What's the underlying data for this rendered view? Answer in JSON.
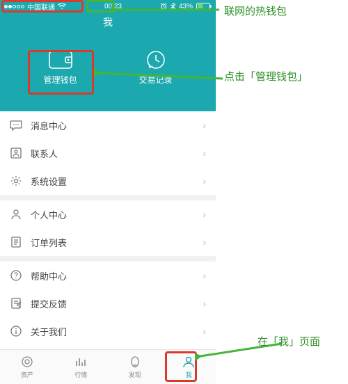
{
  "status": {
    "carrier": "中国联通",
    "time": "00:23",
    "battery_pct": "43%"
  },
  "header": {
    "title": "我",
    "actions": {
      "manage_wallet": "管理钱包",
      "tx_history": "交易记录"
    }
  },
  "menu": {
    "group1": [
      {
        "icon": "chat-icon",
        "label": "消息中心"
      },
      {
        "icon": "contact-icon",
        "label": "联系人"
      },
      {
        "icon": "gear-icon",
        "label": "系统设置"
      }
    ],
    "group2": [
      {
        "icon": "person-icon",
        "label": "个人中心"
      },
      {
        "icon": "list-icon",
        "label": "订单列表"
      }
    ],
    "group3": [
      {
        "icon": "help-icon",
        "label": "帮助中心"
      },
      {
        "icon": "feedback-icon",
        "label": "提交反馈"
      },
      {
        "icon": "info-icon",
        "label": "关于我们"
      }
    ]
  },
  "tabs": [
    {
      "icon": "assets-icon",
      "label": "资产"
    },
    {
      "icon": "market-icon",
      "label": "行情"
    },
    {
      "icon": "discover-icon",
      "label": "发现"
    },
    {
      "icon": "me-icon",
      "label": "我"
    }
  ],
  "annotations": {
    "hot_wallet": "联网的热钱包",
    "click_manage": "点击「管理钱包」",
    "on_me_page": "在「我」页面"
  }
}
